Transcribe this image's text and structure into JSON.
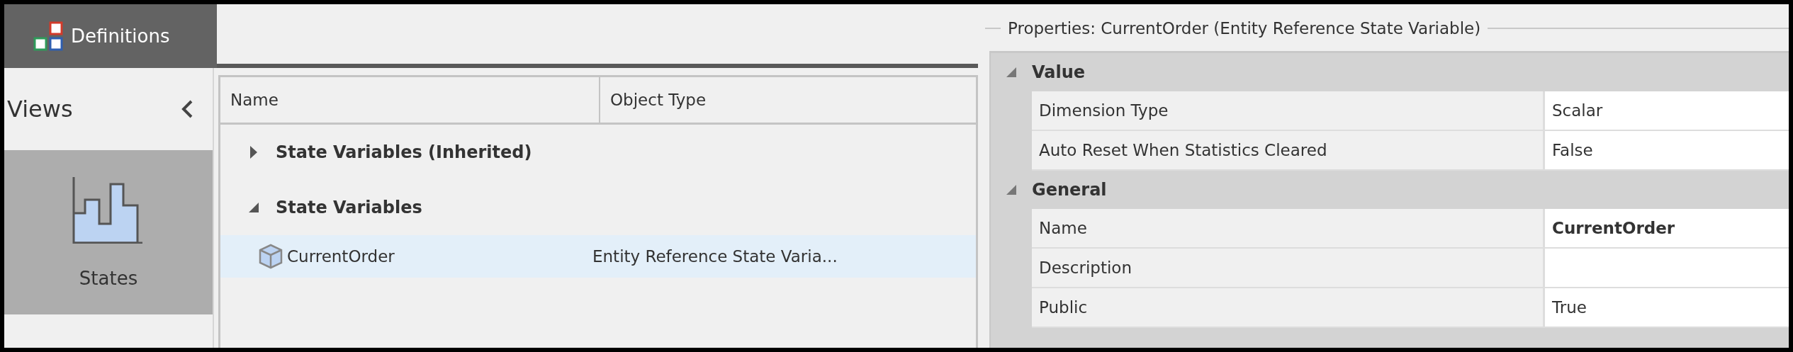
{
  "header": {
    "tab": {
      "label": "Definitions",
      "selected": true
    }
  },
  "views": {
    "title": "Views",
    "items": [
      {
        "label": "States",
        "selected": true
      }
    ]
  },
  "tree": {
    "columns": [
      "Name",
      "Object Type"
    ],
    "nodes": [
      {
        "label": "State Variables (Inherited)",
        "expanded": false
      },
      {
        "label": "State Variables",
        "expanded": true,
        "children": [
          {
            "name": "CurrentOrder",
            "object_type": "Entity Reference State Varia...",
            "selected": true
          }
        ]
      }
    ]
  },
  "properties": {
    "title": "Properties: CurrentOrder (Entity Reference State Variable)",
    "categories": [
      {
        "label": "Value",
        "expanded": true,
        "rows": [
          {
            "name": "Dimension Type",
            "value": "Scalar",
            "bold": false
          },
          {
            "name": "Auto Reset When Statistics Cleared",
            "value": "False",
            "bold": false
          }
        ]
      },
      {
        "label": "General",
        "expanded": true,
        "rows": [
          {
            "name": "Name",
            "value": "CurrentOrder",
            "bold": true
          },
          {
            "name": "Description",
            "bold": false
          },
          {
            "name": "Public",
            "value": "True",
            "bold": false
          }
        ]
      }
    ]
  }
}
